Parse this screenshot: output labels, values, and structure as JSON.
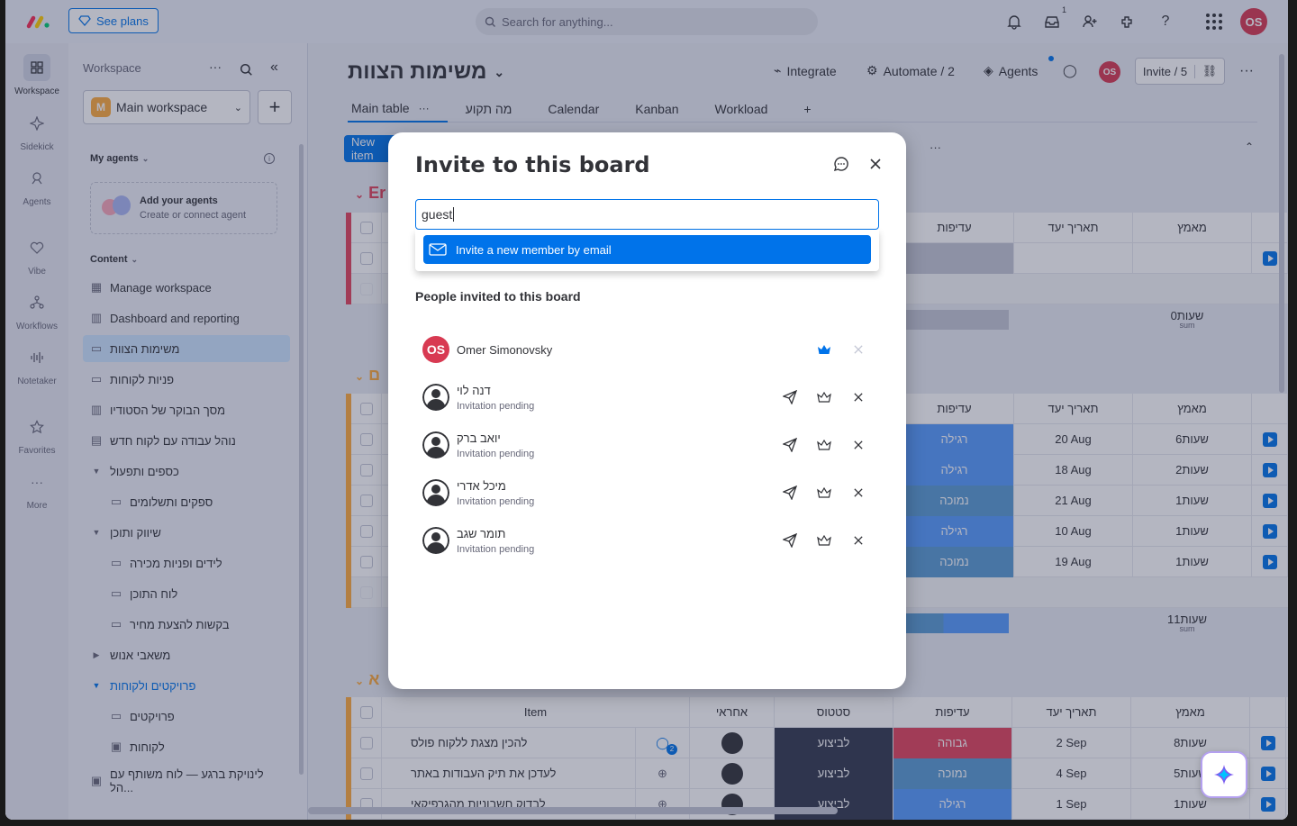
{
  "topbar": {
    "see_plans": "See plans",
    "search_placeholder": "Search for anything...",
    "inbox_badge": "1",
    "user_initials": "OS"
  },
  "rail": [
    {
      "label": "Workspace",
      "icon": "grid-icon"
    },
    {
      "label": "Sidekick",
      "icon": "sparkle-icon"
    },
    {
      "label": "Agents",
      "icon": "agent-icon"
    },
    {
      "label": "Vibe",
      "icon": "heart-icon"
    },
    {
      "label": "Workflows",
      "icon": "workflow-icon"
    },
    {
      "label": "Notetaker",
      "icon": "soundwave-icon"
    },
    {
      "label": "Favorites",
      "icon": "star-icon"
    },
    {
      "label": "More",
      "icon": "dots-icon"
    }
  ],
  "sidebar": {
    "header": "Workspace",
    "workspace_name": "Main workspace",
    "workspace_badge": "M",
    "my_agents": "My agents",
    "add_agents_title": "Add your agents",
    "add_agents_sub": "Create or connect agent",
    "content_label": "Content",
    "items": [
      {
        "label": "Manage workspace",
        "icon": "apps-icon"
      },
      {
        "label": "Dashboard and reporting",
        "icon": "dashboard-icon"
      },
      {
        "label": "משימות הצוות",
        "icon": "board-icon"
      },
      {
        "label": "פניות לקוחות",
        "icon": "board-icon"
      },
      {
        "label": "מסך הבוקר של הסטודיו",
        "icon": "dashboard-icon"
      },
      {
        "label": "נוהל עבודה עם לקוח חדש",
        "icon": "doc-icon"
      },
      {
        "label": "כספים ותפעול",
        "icon": "folder-caret-icon"
      },
      {
        "label": "ספקים ותשלומים",
        "icon": "board-icon"
      },
      {
        "label": "שיווק ותוכן",
        "icon": "folder-caret-icon"
      },
      {
        "label": "לידים ופניות מכירה",
        "icon": "board-icon"
      },
      {
        "label": "לוח התוכן",
        "icon": "board-icon"
      },
      {
        "label": "בקשות להצעת מחיר",
        "icon": "board-icon"
      },
      {
        "label": "משאבי אנוש",
        "icon": "folder-caret-right-icon"
      },
      {
        "label": "פרויקטים ולקוחות",
        "icon": "folder-caret-icon"
      },
      {
        "label": "פרויקטים",
        "icon": "board-icon"
      },
      {
        "label": "לקוחות",
        "icon": "board-share-icon"
      },
      {
        "label": "לינויקת ברגע — לוח משותף עם הל...",
        "icon": "board-share-icon"
      }
    ]
  },
  "board": {
    "title": "משימות הצוות",
    "integrate": "Integrate",
    "automate": "Automate / 2",
    "agents": "Agents",
    "invite": "Invite / 5",
    "tabs": [
      "Main table",
      "מה תקוע",
      "Calendar",
      "Kanban",
      "Workload"
    ],
    "new_item": "New item",
    "group1_letter": "Er",
    "group2_letter": "ם",
    "group3_letter": "א",
    "col_priority": "עדיפות",
    "col_due": "תאריך יעד",
    "col_effort": "מאמץ",
    "col_item": "Item",
    "col_owner": "אחראי",
    "col_status": "סטטוס",
    "sum1": "0שעות",
    "sum2": "11שעות",
    "sum_label": "sum",
    "rows_g2": [
      {
        "priority": "רגילה",
        "pcolor": "#579bfc",
        "due": "20 Aug",
        "effort": "6שעות"
      },
      {
        "priority": "רגילה",
        "pcolor": "#579bfc",
        "due": "18 Aug",
        "effort": "2שעות"
      },
      {
        "priority": "נמוכה",
        "pcolor": "#5a9bd3",
        "due": "21 Aug",
        "effort": "1שעות"
      },
      {
        "priority": "רגילה",
        "pcolor": "#579bfc",
        "due": "10 Aug",
        "effort": "1שעות"
      },
      {
        "priority": "נמוכה",
        "pcolor": "#5a9bd3",
        "due": "19 Aug",
        "effort": "1שעות"
      }
    ],
    "rows_g3": [
      {
        "item": "להכין מצגת ללקוח פולס",
        "status": "לביצוע",
        "priority": "גבוהה",
        "pcolor": "#e2445c",
        "due": "2 Sep",
        "effort": "8שעות",
        "updates": "2"
      },
      {
        "item": "לעדכן את תיק העבודות באתר",
        "status": "לביצוע",
        "priority": "נמוכה",
        "pcolor": "#5a9bd3",
        "due": "4 Sep",
        "effort": "5שעות",
        "updates": ""
      },
      {
        "item": "לבדוק חשבוניות מהגרפיקאי",
        "status": "לביצוע",
        "priority": "רגילה",
        "pcolor": "#579bfc",
        "due": "1 Sep",
        "effort": "1שעות",
        "updates": ""
      }
    ]
  },
  "modal": {
    "title": "Invite to this board",
    "input_value": "guest",
    "dropdown_option": "Invite a new member by email",
    "section": "People invited to this board",
    "people": [
      {
        "name": "Omer Simonovsky",
        "status": "",
        "initials": "OS",
        "owner": true
      },
      {
        "name": "דנה לוי",
        "status": "Invitation pending",
        "initials": "",
        "owner": false
      },
      {
        "name": "יואב ברק",
        "status": "Invitation pending",
        "initials": "",
        "owner": false
      },
      {
        "name": "מיכל אדרי",
        "status": "Invitation pending",
        "initials": "",
        "owner": false
      },
      {
        "name": "תומר שגב",
        "status": "Invitation pending",
        "initials": "",
        "owner": false
      }
    ]
  },
  "colors": {
    "accent": "#0073ea",
    "avatar": "#d83a52",
    "status_todo": "#333a4f",
    "group_red": "#e2445c",
    "group_orange": "#fdab3d"
  }
}
